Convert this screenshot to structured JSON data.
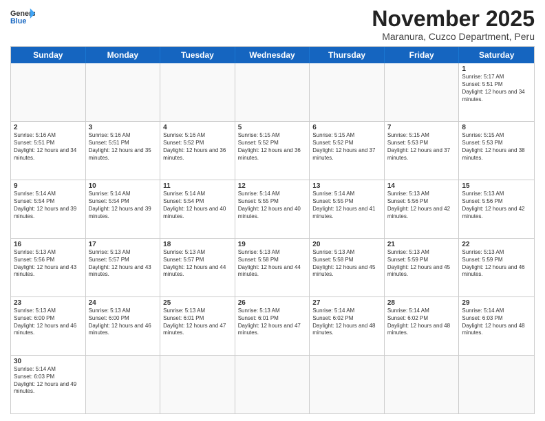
{
  "logo": {
    "text_general": "General",
    "text_blue": "Blue"
  },
  "header": {
    "month_title": "November 2025",
    "subtitle": "Maranura, Cuzco Department, Peru"
  },
  "days_of_week": [
    "Sunday",
    "Monday",
    "Tuesday",
    "Wednesday",
    "Thursday",
    "Friday",
    "Saturday"
  ],
  "weeks": [
    [
      {
        "day": "",
        "info": ""
      },
      {
        "day": "",
        "info": ""
      },
      {
        "day": "",
        "info": ""
      },
      {
        "day": "",
        "info": ""
      },
      {
        "day": "",
        "info": ""
      },
      {
        "day": "",
        "info": ""
      },
      {
        "day": "1",
        "info": "Sunrise: 5:17 AM\nSunset: 5:51 PM\nDaylight: 12 hours and 34 minutes."
      }
    ],
    [
      {
        "day": "2",
        "info": "Sunrise: 5:16 AM\nSunset: 5:51 PM\nDaylight: 12 hours and 34 minutes."
      },
      {
        "day": "3",
        "info": "Sunrise: 5:16 AM\nSunset: 5:51 PM\nDaylight: 12 hours and 35 minutes."
      },
      {
        "day": "4",
        "info": "Sunrise: 5:16 AM\nSunset: 5:52 PM\nDaylight: 12 hours and 36 minutes."
      },
      {
        "day": "5",
        "info": "Sunrise: 5:15 AM\nSunset: 5:52 PM\nDaylight: 12 hours and 36 minutes."
      },
      {
        "day": "6",
        "info": "Sunrise: 5:15 AM\nSunset: 5:52 PM\nDaylight: 12 hours and 37 minutes."
      },
      {
        "day": "7",
        "info": "Sunrise: 5:15 AM\nSunset: 5:53 PM\nDaylight: 12 hours and 37 minutes."
      },
      {
        "day": "8",
        "info": "Sunrise: 5:15 AM\nSunset: 5:53 PM\nDaylight: 12 hours and 38 minutes."
      }
    ],
    [
      {
        "day": "9",
        "info": "Sunrise: 5:14 AM\nSunset: 5:54 PM\nDaylight: 12 hours and 39 minutes."
      },
      {
        "day": "10",
        "info": "Sunrise: 5:14 AM\nSunset: 5:54 PM\nDaylight: 12 hours and 39 minutes."
      },
      {
        "day": "11",
        "info": "Sunrise: 5:14 AM\nSunset: 5:54 PM\nDaylight: 12 hours and 40 minutes."
      },
      {
        "day": "12",
        "info": "Sunrise: 5:14 AM\nSunset: 5:55 PM\nDaylight: 12 hours and 40 minutes."
      },
      {
        "day": "13",
        "info": "Sunrise: 5:14 AM\nSunset: 5:55 PM\nDaylight: 12 hours and 41 minutes."
      },
      {
        "day": "14",
        "info": "Sunrise: 5:13 AM\nSunset: 5:56 PM\nDaylight: 12 hours and 42 minutes."
      },
      {
        "day": "15",
        "info": "Sunrise: 5:13 AM\nSunset: 5:56 PM\nDaylight: 12 hours and 42 minutes."
      }
    ],
    [
      {
        "day": "16",
        "info": "Sunrise: 5:13 AM\nSunset: 5:56 PM\nDaylight: 12 hours and 43 minutes."
      },
      {
        "day": "17",
        "info": "Sunrise: 5:13 AM\nSunset: 5:57 PM\nDaylight: 12 hours and 43 minutes."
      },
      {
        "day": "18",
        "info": "Sunrise: 5:13 AM\nSunset: 5:57 PM\nDaylight: 12 hours and 44 minutes."
      },
      {
        "day": "19",
        "info": "Sunrise: 5:13 AM\nSunset: 5:58 PM\nDaylight: 12 hours and 44 minutes."
      },
      {
        "day": "20",
        "info": "Sunrise: 5:13 AM\nSunset: 5:58 PM\nDaylight: 12 hours and 45 minutes."
      },
      {
        "day": "21",
        "info": "Sunrise: 5:13 AM\nSunset: 5:59 PM\nDaylight: 12 hours and 45 minutes."
      },
      {
        "day": "22",
        "info": "Sunrise: 5:13 AM\nSunset: 5:59 PM\nDaylight: 12 hours and 46 minutes."
      }
    ],
    [
      {
        "day": "23",
        "info": "Sunrise: 5:13 AM\nSunset: 6:00 PM\nDaylight: 12 hours and 46 minutes."
      },
      {
        "day": "24",
        "info": "Sunrise: 5:13 AM\nSunset: 6:00 PM\nDaylight: 12 hours and 46 minutes."
      },
      {
        "day": "25",
        "info": "Sunrise: 5:13 AM\nSunset: 6:01 PM\nDaylight: 12 hours and 47 minutes."
      },
      {
        "day": "26",
        "info": "Sunrise: 5:13 AM\nSunset: 6:01 PM\nDaylight: 12 hours and 47 minutes."
      },
      {
        "day": "27",
        "info": "Sunrise: 5:14 AM\nSunset: 6:02 PM\nDaylight: 12 hours and 48 minutes."
      },
      {
        "day": "28",
        "info": "Sunrise: 5:14 AM\nSunset: 6:02 PM\nDaylight: 12 hours and 48 minutes."
      },
      {
        "day": "29",
        "info": "Sunrise: 5:14 AM\nSunset: 6:03 PM\nDaylight: 12 hours and 48 minutes."
      }
    ],
    [
      {
        "day": "30",
        "info": "Sunrise: 5:14 AM\nSunset: 6:03 PM\nDaylight: 12 hours and 49 minutes."
      },
      {
        "day": "",
        "info": ""
      },
      {
        "day": "",
        "info": ""
      },
      {
        "day": "",
        "info": ""
      },
      {
        "day": "",
        "info": ""
      },
      {
        "day": "",
        "info": ""
      },
      {
        "day": "",
        "info": ""
      }
    ]
  ]
}
